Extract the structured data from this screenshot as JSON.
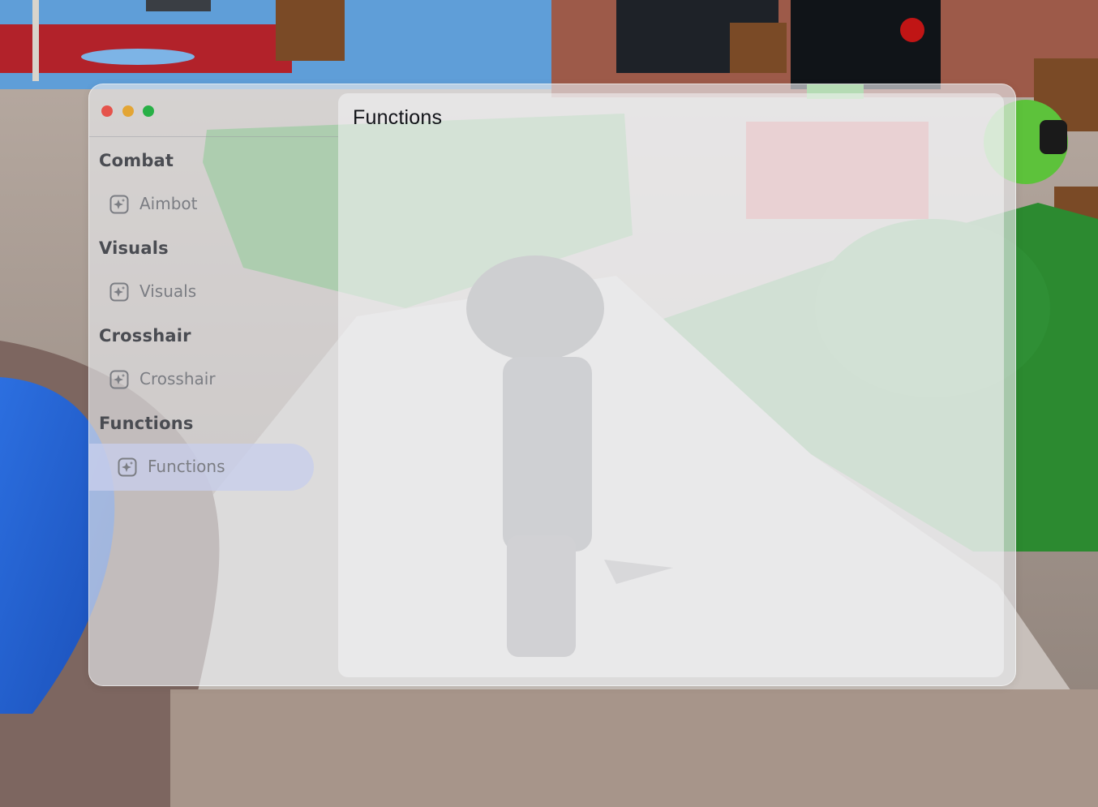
{
  "window": {
    "controls": {
      "close_color": "#e5534b",
      "minimize_color": "#e3a534",
      "maximize_color": "#28b046"
    }
  },
  "sidebar": {
    "sections": [
      {
        "title": "Combat",
        "items": [
          {
            "label": "Aimbot",
            "icon": "sparkle-square-icon",
            "active": false
          }
        ]
      },
      {
        "title": "Visuals",
        "items": [
          {
            "label": "Visuals",
            "icon": "sparkle-square-icon",
            "active": false
          }
        ]
      },
      {
        "title": "Crosshair",
        "items": [
          {
            "label": "Crosshair",
            "icon": "sparkle-square-icon",
            "active": false
          }
        ]
      },
      {
        "title": "Functions",
        "items": [
          {
            "label": "Functions",
            "icon": "sparkle-square-icon",
            "active": true
          }
        ]
      }
    ]
  },
  "content": {
    "title": "Functions"
  },
  "colors": {
    "active_item_bg": "#c8ceec",
    "section_title": "#4a4c52",
    "item_text": "#7b7d83"
  }
}
